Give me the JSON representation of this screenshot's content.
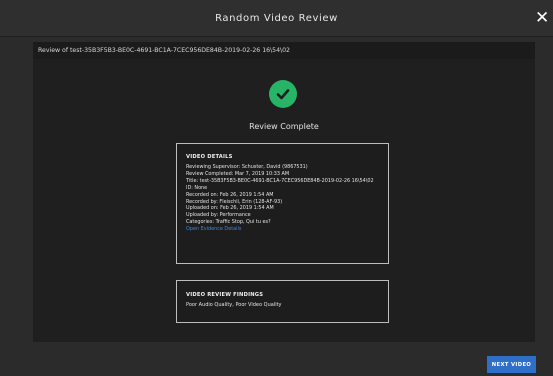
{
  "window": {
    "title": "Random Video Review",
    "close_glyph": "✕"
  },
  "file_bar": {
    "title": "Review of test-35B3F5B3-BE0C-4691-BC1A-7CEC956DE84B-2019-02-26 16\\54\\02"
  },
  "status": {
    "icon": "check-circle-icon",
    "text": "Review Complete",
    "color": "#27b466"
  },
  "video_details": {
    "heading": "VIDEO DETAILS",
    "lines": [
      "Reviewing Supervisor: Schuster, David (9867531)",
      "Review Completed: Mar 7, 2019 10:33 AM",
      "Title: test-35B3F5B3-BE0C-4691-BC1A-7CEC956DE84B-2019-02-26 16\\54\\02",
      "ID: None",
      "Recorded on: Feb 26, 2019 1:54 AM",
      "Recorded by: Fleischli, Erin (128-AF-93)",
      "Uploaded on: Feb 26, 2019 1:54 AM",
      "Uploaded by: Performance",
      "Categories: Traffic Stop, Qui tu es?"
    ],
    "link": "Open Evidence Details",
    "link_color": "#3f86d9"
  },
  "findings": {
    "heading": "VIDEO REVIEW FINDINGS",
    "text": "Poor Audio Quality, Poor Video Quality"
  },
  "footer": {
    "next_label": "NEXT VIDEO",
    "button_color": "#2f6fc8"
  }
}
